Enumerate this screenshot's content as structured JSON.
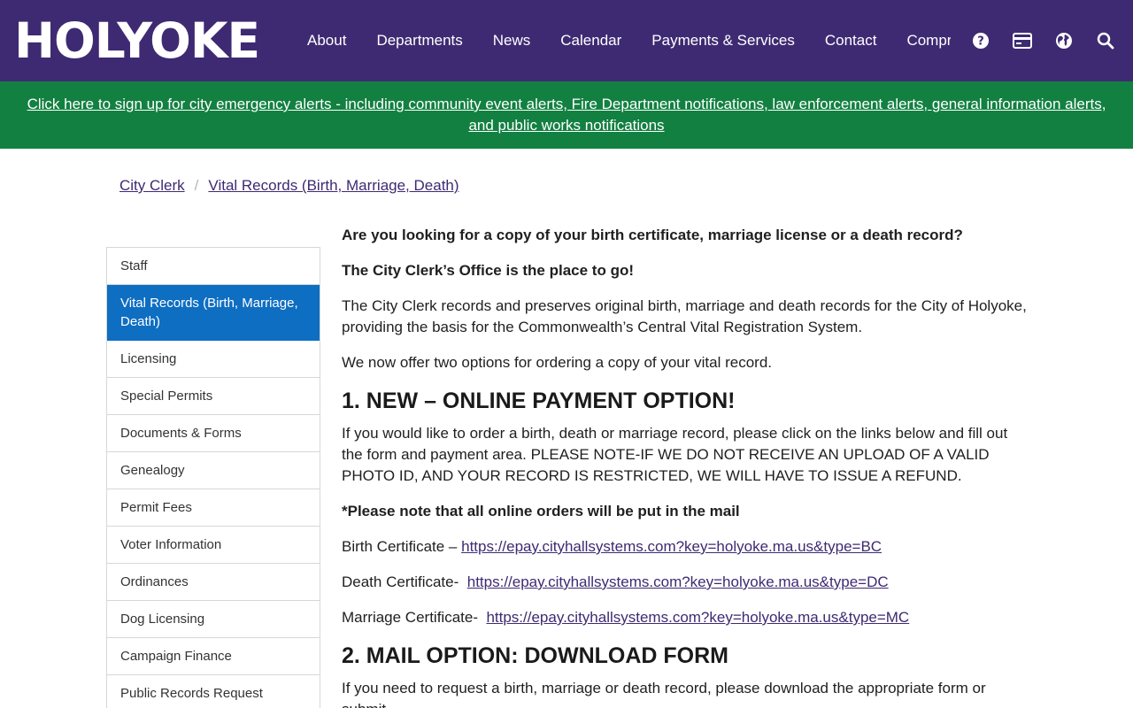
{
  "header": {
    "logo_text": "HOLYOKE",
    "nav": [
      {
        "label": "About"
      },
      {
        "label": "Departments"
      },
      {
        "label": "News"
      },
      {
        "label": "Calendar"
      },
      {
        "label": "Payments & Services"
      },
      {
        "label": "Contact"
      },
      {
        "label": "Comprehensive Plan"
      }
    ],
    "utility_icons": [
      "help-icon",
      "credit-card-icon",
      "globe-icon",
      "search-icon"
    ]
  },
  "alert": {
    "text": "Click here to sign up for city emergency alerts - including community event alerts, Fire Department notifications, law enforcement alerts, general information alerts, and public works notifications"
  },
  "breadcrumb": {
    "items": [
      {
        "label": "City Clerk"
      },
      {
        "label": "Vital Records (Birth, Marriage, Death)"
      }
    ],
    "separator": "/"
  },
  "sidebar": {
    "items": [
      {
        "label": "Staff"
      },
      {
        "label": "Vital Records (Birth, Marriage, Death)"
      },
      {
        "label": "Licensing"
      },
      {
        "label": "Special Permits"
      },
      {
        "label": "Documents & Forms"
      },
      {
        "label": "Genealogy"
      },
      {
        "label": "Permit Fees"
      },
      {
        "label": "Voter Information"
      },
      {
        "label": "Ordinances"
      },
      {
        "label": "Dog Licensing"
      },
      {
        "label": "Campaign Finance"
      },
      {
        "label": "Public Records Request"
      }
    ]
  },
  "content": {
    "intro_question": "Are you looking for a copy of your birth certificate, marriage license or a death record?",
    "intro_answer": "The City Clerk’s Office is the place to go!",
    "description": "The City Clerk records and preserves original birth, marriage and death records for the City of Holyoke, providing the basis for the Commonwealth’s Central Vital Registration System.",
    "options_intro": "We now offer two options for ordering a copy of your vital record.",
    "option1_heading": "1. NEW – ONLINE PAYMENT OPTION!",
    "option1_body": "If you would like to order a birth, death or marriage record, please click on the links below and fill out the form and payment area.  PLEASE NOTE-IF WE DO NOT RECEIVE AN UPLOAD OF A VALID PHOTO ID, AND YOUR RECORD IS RESTRICTED, WE WILL HAVE TO ISSUE A REFUND.",
    "mail_note": "*Please note that all online orders will be put in the mail",
    "links": [
      {
        "label": "Birth Certificate – ",
        "url": "https://epay.cityhallsystems.com?key=holyoke.ma.us&type=BC"
      },
      {
        "label": "Death Certificate-  ",
        "url": "https://epay.cityhallsystems.com?key=holyoke.ma.us&type=DC"
      },
      {
        "label": "Marriage Certificate-  ",
        "url": "https://epay.cityhallsystems.com?key=holyoke.ma.us&type=MC"
      }
    ],
    "option2_heading": "2. MAIL OPTION: DOWNLOAD FORM",
    "option2_body": "If you need to request a birth, marriage or death record, please download the appropriate form or submit"
  }
}
